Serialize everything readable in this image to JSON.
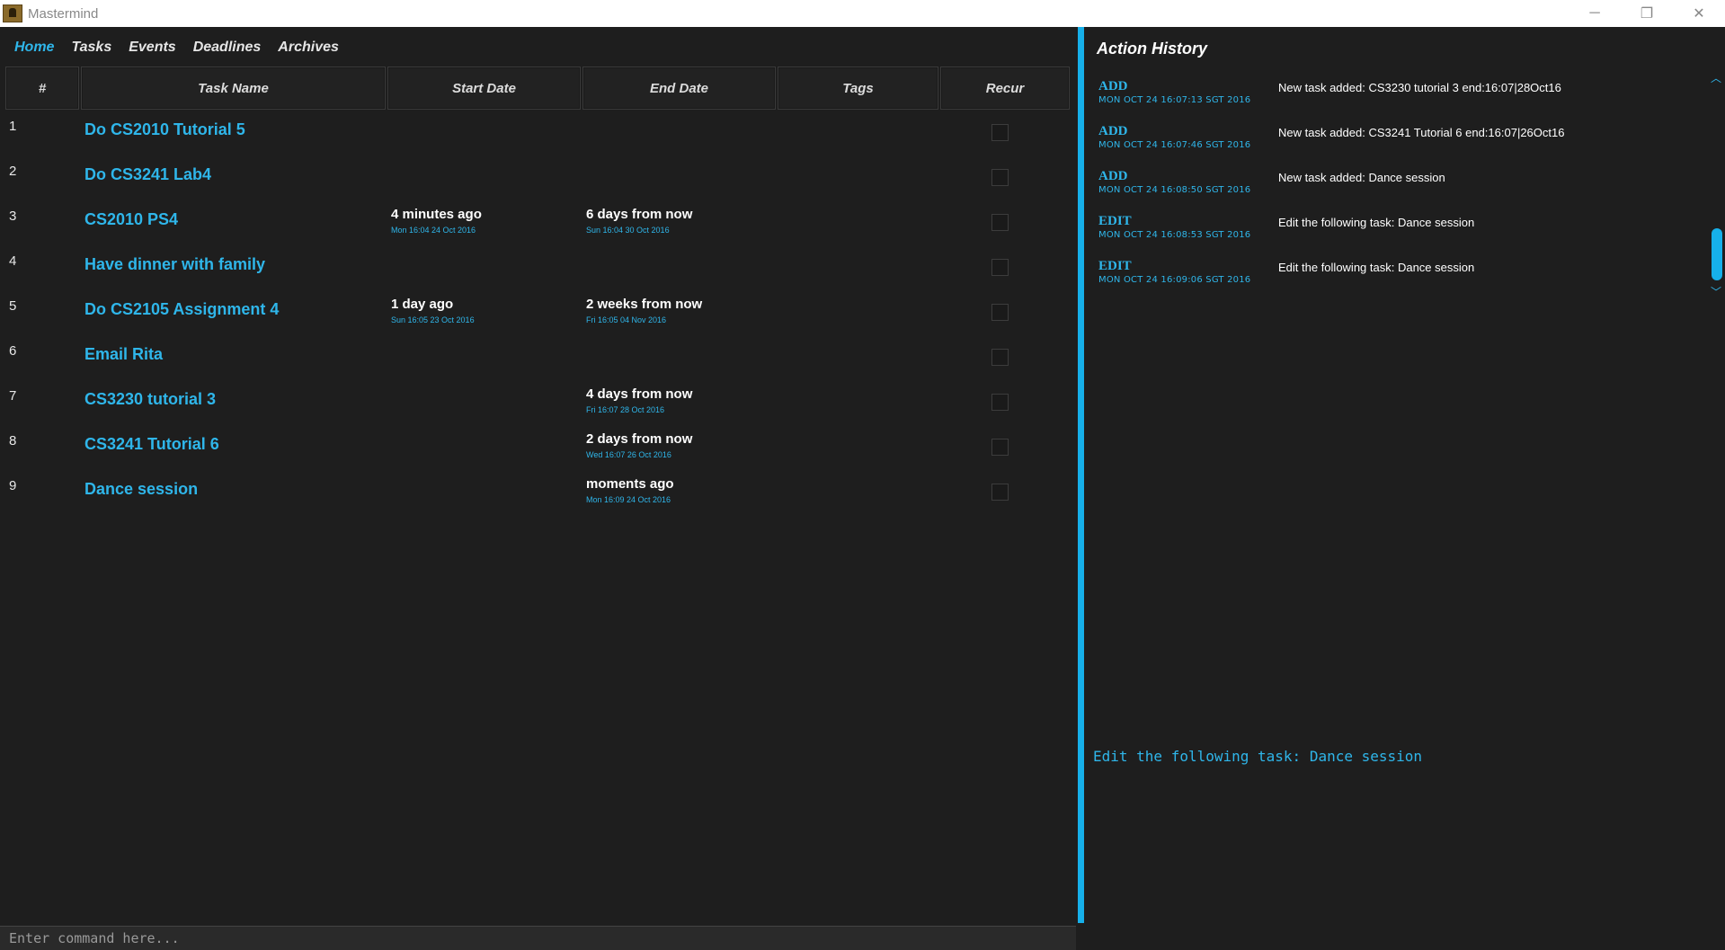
{
  "window": {
    "title": "Mastermind",
    "controls": {
      "minimize": "─",
      "restore": "❐",
      "close": "✕"
    }
  },
  "nav": [
    {
      "label": "Home",
      "active": true
    },
    {
      "label": "Tasks",
      "active": false
    },
    {
      "label": "Events",
      "active": false
    },
    {
      "label": "Deadlines",
      "active": false
    },
    {
      "label": "Archives",
      "active": false
    }
  ],
  "table": {
    "columns": [
      "#",
      "Task Name",
      "Start Date",
      "End Date",
      "Tags",
      "Recur"
    ],
    "rows": [
      {
        "num": "1",
        "name": "Do CS2010 Tutorial 5",
        "start_rel": "",
        "start_abs": "",
        "end_rel": "",
        "end_abs": ""
      },
      {
        "num": "2",
        "name": "Do CS3241 Lab4",
        "start_rel": "",
        "start_abs": "",
        "end_rel": "",
        "end_abs": ""
      },
      {
        "num": "3",
        "name": "CS2010 PS4",
        "start_rel": "4 minutes ago",
        "start_abs": "Mon 16:04 24 Oct 2016",
        "end_rel": "6 days from now",
        "end_abs": "Sun 16:04 30 Oct 2016"
      },
      {
        "num": "4",
        "name": "Have dinner with family",
        "start_rel": "",
        "start_abs": "",
        "end_rel": "",
        "end_abs": ""
      },
      {
        "num": "5",
        "name": "Do CS2105 Assignment 4",
        "start_rel": "1 day ago",
        "start_abs": "Sun 16:05 23 Oct 2016",
        "end_rel": "2 weeks from now",
        "end_abs": "Fri 16:05 04 Nov 2016"
      },
      {
        "num": "6",
        "name": "Email Rita",
        "start_rel": "",
        "start_abs": "",
        "end_rel": "",
        "end_abs": ""
      },
      {
        "num": "7",
        "name": "CS3230 tutorial 3",
        "start_rel": "",
        "start_abs": "",
        "end_rel": "4 days from now",
        "end_abs": "Fri 16:07 28 Oct 2016"
      },
      {
        "num": "8",
        "name": "CS3241 Tutorial 6",
        "start_rel": "",
        "start_abs": "",
        "end_rel": "2 days from now",
        "end_abs": "Wed 16:07 26 Oct 2016"
      },
      {
        "num": "9",
        "name": "Dance session",
        "start_rel": "",
        "start_abs": "",
        "end_rel": "moments ago",
        "end_abs": "Mon 16:09 24 Oct 2016"
      }
    ]
  },
  "command": {
    "placeholder": "Enter command here..."
  },
  "history": {
    "title": "Action History",
    "items": [
      {
        "type": "ADD",
        "time": "MON OCT 24 16:07:13 SGT 2016",
        "desc": "New task added: CS3230 tutorial 3 end:16:07|28Oct16"
      },
      {
        "type": "ADD",
        "time": "MON OCT 24 16:07:46 SGT 2016",
        "desc": "New task added: CS3241 Tutorial 6 end:16:07|26Oct16"
      },
      {
        "type": "ADD",
        "time": "MON OCT 24 16:08:50 SGT 2016",
        "desc": "New task added: Dance session"
      },
      {
        "type": "EDIT",
        "time": "MON OCT 24 16:08:53 SGT 2016",
        "desc": "Edit the following task: Dance session"
      },
      {
        "type": "EDIT",
        "time": "MON OCT 24 16:09:06 SGT 2016",
        "desc": "Edit the following task: Dance session"
      }
    ],
    "scroll_up": "︿",
    "scroll_down": "﹀"
  },
  "feedback": "Edit the following task: Dance session",
  "colors": {
    "accent": "#2fb6ea",
    "divider": "#16b0ea",
    "background": "#1e1e1e"
  }
}
